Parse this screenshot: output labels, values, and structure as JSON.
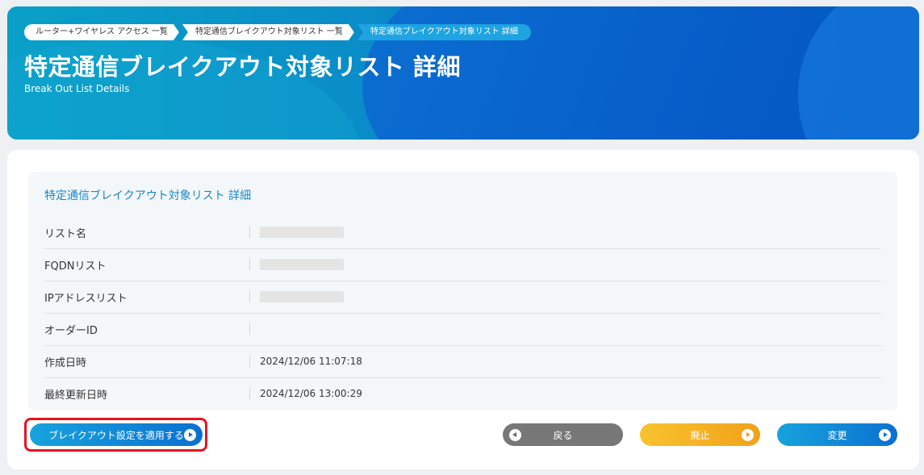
{
  "breadcrumbs": [
    "ルーター+ワイヤレス アクセス 一覧",
    "特定通信ブレイクアウト対象リスト 一覧",
    "特定通信ブレイクアウト対象リスト 詳細"
  ],
  "header": {
    "title": "特定通信ブレイクアウト対象リスト 詳細",
    "subtitle": "Break Out List Details"
  },
  "panel": {
    "title": "特定通信ブレイクアウト対象リスト 詳細",
    "rows": [
      {
        "label": "リスト名",
        "value": "",
        "redacted": true
      },
      {
        "label": "FQDNリスト",
        "value": "",
        "redacted": true
      },
      {
        "label": "IPアドレスリスト",
        "value": "",
        "redacted": true
      },
      {
        "label": "オーダーID",
        "value": "",
        "redacted": false
      },
      {
        "label": "作成日時",
        "value": "2024/12/06 11:07:18",
        "redacted": false
      },
      {
        "label": "最終更新日時",
        "value": "2024/12/06 13:00:29",
        "redacted": false
      }
    ]
  },
  "buttons": {
    "apply": "ブレイクアウト設定を適用する",
    "back": "戻る",
    "discard": "廃止",
    "change": "変更"
  },
  "colors": {
    "accent": "#0b70d0",
    "highlight": "#e8141d",
    "discard": "#f0a21a",
    "back": "#777777"
  }
}
